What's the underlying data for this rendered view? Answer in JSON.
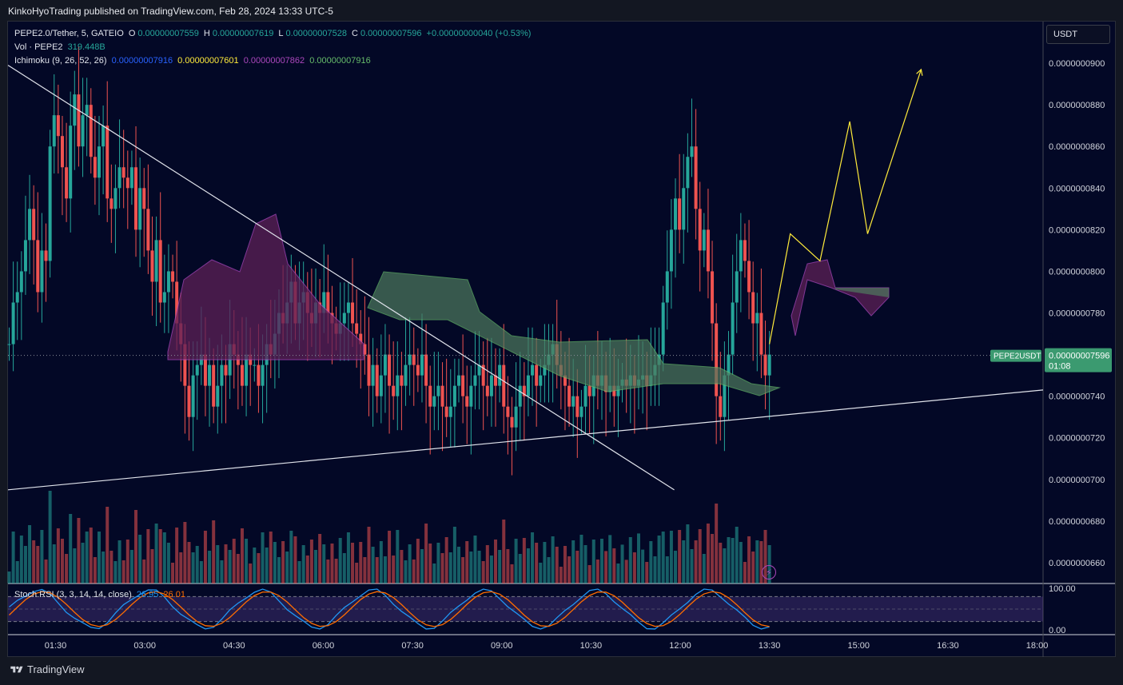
{
  "publisher": "KinkoHyoTrading published on TradingView.com, Feb 28, 2024 13:33 UTC-5",
  "legend": {
    "symbol": "PEPE2.0/Tether, 5, GATEIO",
    "o_label": "O",
    "o": "0.00000007559",
    "h_label": "H",
    "h": "0.00000007619",
    "l_label": "L",
    "l": "0.00000007528",
    "c_label": "C",
    "c": "0.00000007596",
    "change": "+0.00000000040 (+0.53%)",
    "vol_label": "Vol · PEPE2",
    "vol": "319.448B",
    "ichimoku_label": "Ichimoku (9, 26, 52, 26)",
    "ichi_conv": "0.00000007916",
    "ichi_base": "0.00000007601",
    "ichi_spanb": "0.00000007862",
    "ichi_lead": "0.00000007916",
    "stoch_label": "Stoch RSI (3, 3, 14, 14, close)",
    "stoch_k": "26.95",
    "stoch_d": "26.01"
  },
  "currency_button": "USDT",
  "price_tag": {
    "symbol": "PEPE2USDT",
    "price": "0.00000007596",
    "countdown": "01:08"
  },
  "footer_brand": "TradingView",
  "colors": {
    "up": "#26a69a",
    "down": "#ef5350",
    "bg": "#030826",
    "kijun_yellow": "#ffeb3b",
    "tenkan_blue": "#2962ff",
    "cloud_green": "#4e7a5e",
    "cloud_purple": "#5d2057",
    "stoch_k": "#2196f3",
    "stoch_d": "#ff6d00"
  },
  "chart_data": {
    "type": "candlestick",
    "symbol": "PEPE2.0/Tether",
    "timeframe": "5",
    "exchange": "GATEIO",
    "price_axis": {
      "ticks": [
        "0.0000000900",
        "0.0000000880",
        "0.0000000860",
        "0.0000000840",
        "0.0000000820",
        "0.0000000800",
        "0.0000000780",
        "0.0000000760",
        "0.0000000740",
        "0.0000000720",
        "0.0000000700",
        "0.0000000680",
        "0.0000000660"
      ],
      "tick_values": [
        9e-08,
        8.8e-08,
        8.6e-08,
        8.4e-08,
        8.2e-08,
        8e-08,
        7.8e-08,
        7.6e-08,
        7.4e-08,
        7.2e-08,
        7e-08,
        6.8e-08,
        6.6e-08
      ],
      "range": [
        6.5e-08,
        9.2e-08
      ]
    },
    "time_axis": {
      "ticks": [
        "01:30",
        "03:00",
        "04:30",
        "06:00",
        "07:30",
        "09:00",
        "10:30",
        "12:00",
        "13:30",
        "15:00",
        "16:30",
        "18:00"
      ],
      "tick_hours": [
        1.5,
        3,
        4.5,
        6,
        7.5,
        9,
        10.5,
        12,
        13.5,
        15,
        16.5,
        18
      ],
      "range_hours": [
        0.7,
        18.1
      ]
    },
    "stoch_axis": {
      "ticks": [
        "100.00",
        "0.00"
      ],
      "tick_values": [
        100,
        0
      ],
      "bands": [
        80,
        20
      ]
    },
    "last_price": 7.596e-08,
    "candles_close": [
      7.65,
      7.85,
      7.9,
      8.0,
      8.15,
      8.3,
      8.15,
      7.9,
      8.1,
      8.05,
      8.6,
      8.75,
      8.65,
      8.5,
      8.35,
      8.7,
      8.85,
      8.6,
      8.75,
      8.8,
      8.55,
      8.45,
      8.6,
      8.7,
      8.35,
      8.3,
      8.4,
      8.5,
      8.45,
      8.4,
      8.5,
      8.2,
      8.4,
      8.3,
      8.1,
      7.95,
      8.15,
      7.85,
      7.9,
      8.0,
      7.95,
      7.75,
      7.65,
      7.45,
      7.3,
      7.5,
      7.55,
      7.6,
      7.45,
      7.55,
      7.35,
      7.45,
      7.55,
      7.5,
      7.65,
      7.6,
      7.55,
      7.45,
      7.6,
      7.55,
      7.55,
      7.45,
      7.55,
      7.65,
      7.6,
      7.7,
      7.8,
      7.75,
      7.85,
      7.95,
      7.75,
      7.85,
      7.9,
      7.8,
      7.75,
      7.85,
      7.8,
      7.9,
      7.8,
      7.75,
      7.7,
      7.75,
      7.8,
      7.85,
      7.75,
      7.7,
      7.65,
      7.6,
      7.45,
      7.55,
      7.4,
      7.5,
      7.6,
      7.45,
      7.4,
      7.5,
      7.45,
      7.55,
      7.6,
      7.55,
      7.5,
      7.6,
      7.45,
      7.35,
      7.4,
      7.45,
      7.35,
      7.3,
      7.35,
      7.45,
      7.5,
      7.4,
      7.35,
      7.45,
      7.5,
      7.55,
      7.45,
      7.4,
      7.5,
      7.45,
      7.55,
      7.35,
      7.3,
      7.25,
      7.35,
      7.45,
      7.4,
      7.5,
      7.55,
      7.45,
      7.5,
      7.55,
      7.6,
      7.65,
      7.55,
      7.5,
      7.45,
      7.35,
      7.4,
      7.3,
      7.35,
      7.45,
      7.4,
      7.5,
      7.45,
      7.5,
      7.42,
      7.45,
      7.4,
      7.45,
      7.48,
      7.45,
      7.5,
      7.45,
      7.48,
      7.5,
      7.45,
      7.5,
      7.55,
      7.6,
      7.85,
      8.0,
      8.2,
      8.35,
      8.2,
      8.4,
      8.55,
      8.6,
      8.3,
      8.1,
      8.2,
      8.0,
      7.75,
      7.4,
      7.3,
      7.5,
      7.6,
      7.85,
      8.0,
      8.15,
      8.05,
      7.9,
      7.75,
      7.8,
      7.6,
      7.5,
      7.6
    ],
    "projection_yellow": [
      [
        13.5,
        7.65
      ],
      [
        13.85,
        8.18
      ],
      [
        14.35,
        8.05
      ],
      [
        14.85,
        8.72
      ],
      [
        15.15,
        8.18
      ],
      [
        16.05,
        8.97
      ]
    ],
    "trendline_upper": [
      [
        0.7,
        8.99
      ],
      [
        11.9,
        6.95
      ]
    ],
    "trendline_lower": [
      [
        0.7,
        6.95
      ],
      [
        18.1,
        7.43
      ]
    ]
  }
}
